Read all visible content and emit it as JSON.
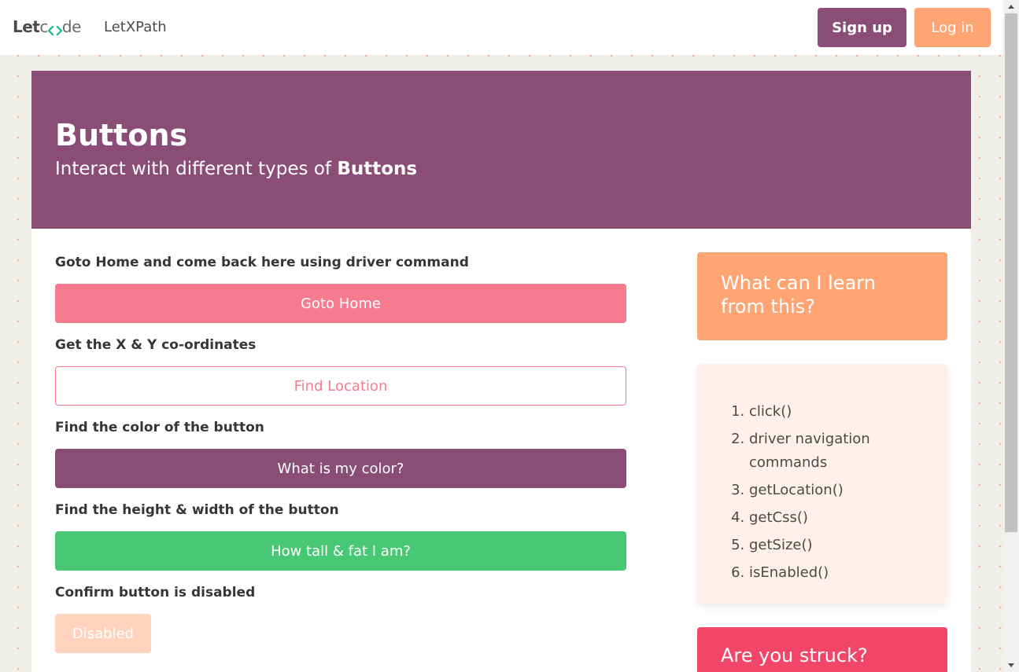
{
  "navbar": {
    "logo_let": "Let",
    "logo_c": "c",
    "logo_de": "de",
    "nav_item": "LetXPath",
    "signup_label": "Sign up",
    "login_label": "Log in"
  },
  "hero": {
    "title": "Buttons",
    "subtitle_prefix": "Interact with different types of ",
    "subtitle_bold": "Buttons"
  },
  "sections": [
    {
      "label": "Goto Home and come back here using driver command",
      "button": "Goto Home"
    },
    {
      "label": "Get the X & Y co-ordinates",
      "button": "Find Location"
    },
    {
      "label": "Find the color of the button",
      "button": "What is my color?"
    },
    {
      "label": "Find the height & width of the button",
      "button": "How tall & fat I am?"
    },
    {
      "label": "Confirm button is disabled",
      "button": "Disabled"
    }
  ],
  "sidebar": {
    "learn_title": "What can I learn from this?",
    "learn_items": [
      "click()",
      "driver navigation commands",
      "getLocation()",
      "getCss()",
      "getSize()",
      "isEnabled()"
    ],
    "struck_title": "Are you struck?"
  },
  "colors": {
    "primary": "#8a4d76",
    "accent": "#ffa473",
    "danger": "#f67b8f",
    "success": "#48c774",
    "struck": "#f14668"
  }
}
